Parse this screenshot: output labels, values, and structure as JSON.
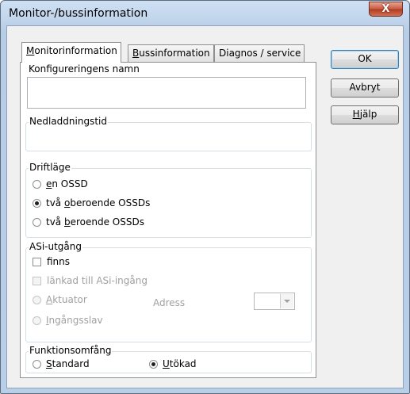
{
  "window": {
    "title": "Monitor-/bussinformation",
    "close_symbol": "X"
  },
  "tabs": [
    {
      "label": "Monitorinformation",
      "accel": "M",
      "rest": "onitorinformation",
      "active": true
    },
    {
      "label": "Bussinformation",
      "accel": "B",
      "rest": "ussinformation",
      "active": false
    },
    {
      "label": "Diagnos / service",
      "accel": "",
      "rest": "Diagnos / service",
      "active": false
    }
  ],
  "config_name": {
    "label": "Konfigureringens namn",
    "value": ""
  },
  "download_time": {
    "label": "Nedladdningstid",
    "value": ""
  },
  "operating_mode": {
    "label": "Driftläge",
    "options": [
      {
        "pre": "",
        "accel": "e",
        "post": "n OSSD",
        "checked": false
      },
      {
        "pre": "två ",
        "accel": "o",
        "post": "beroende OSSDs",
        "checked": true
      },
      {
        "pre": "två ",
        "accel": "b",
        "post": "eroende OSSDs",
        "checked": false
      }
    ]
  },
  "asi_output": {
    "label": "ASi-utgång",
    "finns": {
      "label": "finns",
      "checked": false
    },
    "linked": {
      "label": "länkad till ASi-ingång",
      "checked": false,
      "disabled": true
    },
    "aktuator": {
      "accel": "A",
      "rest": "ktuator",
      "checked": false,
      "disabled": true
    },
    "ingangsslav": {
      "accel": "I",
      "rest": "ngångsslav",
      "checked": false,
      "disabled": true
    },
    "adress_label": "Adress",
    "adress_value": ""
  },
  "function_scope": {
    "label": "Funktionsomfång",
    "standard": {
      "accel": "S",
      "rest": "tandard",
      "checked": false
    },
    "utokad": {
      "accel": "U",
      "rest": "tökad",
      "checked": true
    }
  },
  "buttons": {
    "ok": "OK",
    "cancel": "Avbryt",
    "help_accel": "H",
    "help_rest": "jälp"
  }
}
